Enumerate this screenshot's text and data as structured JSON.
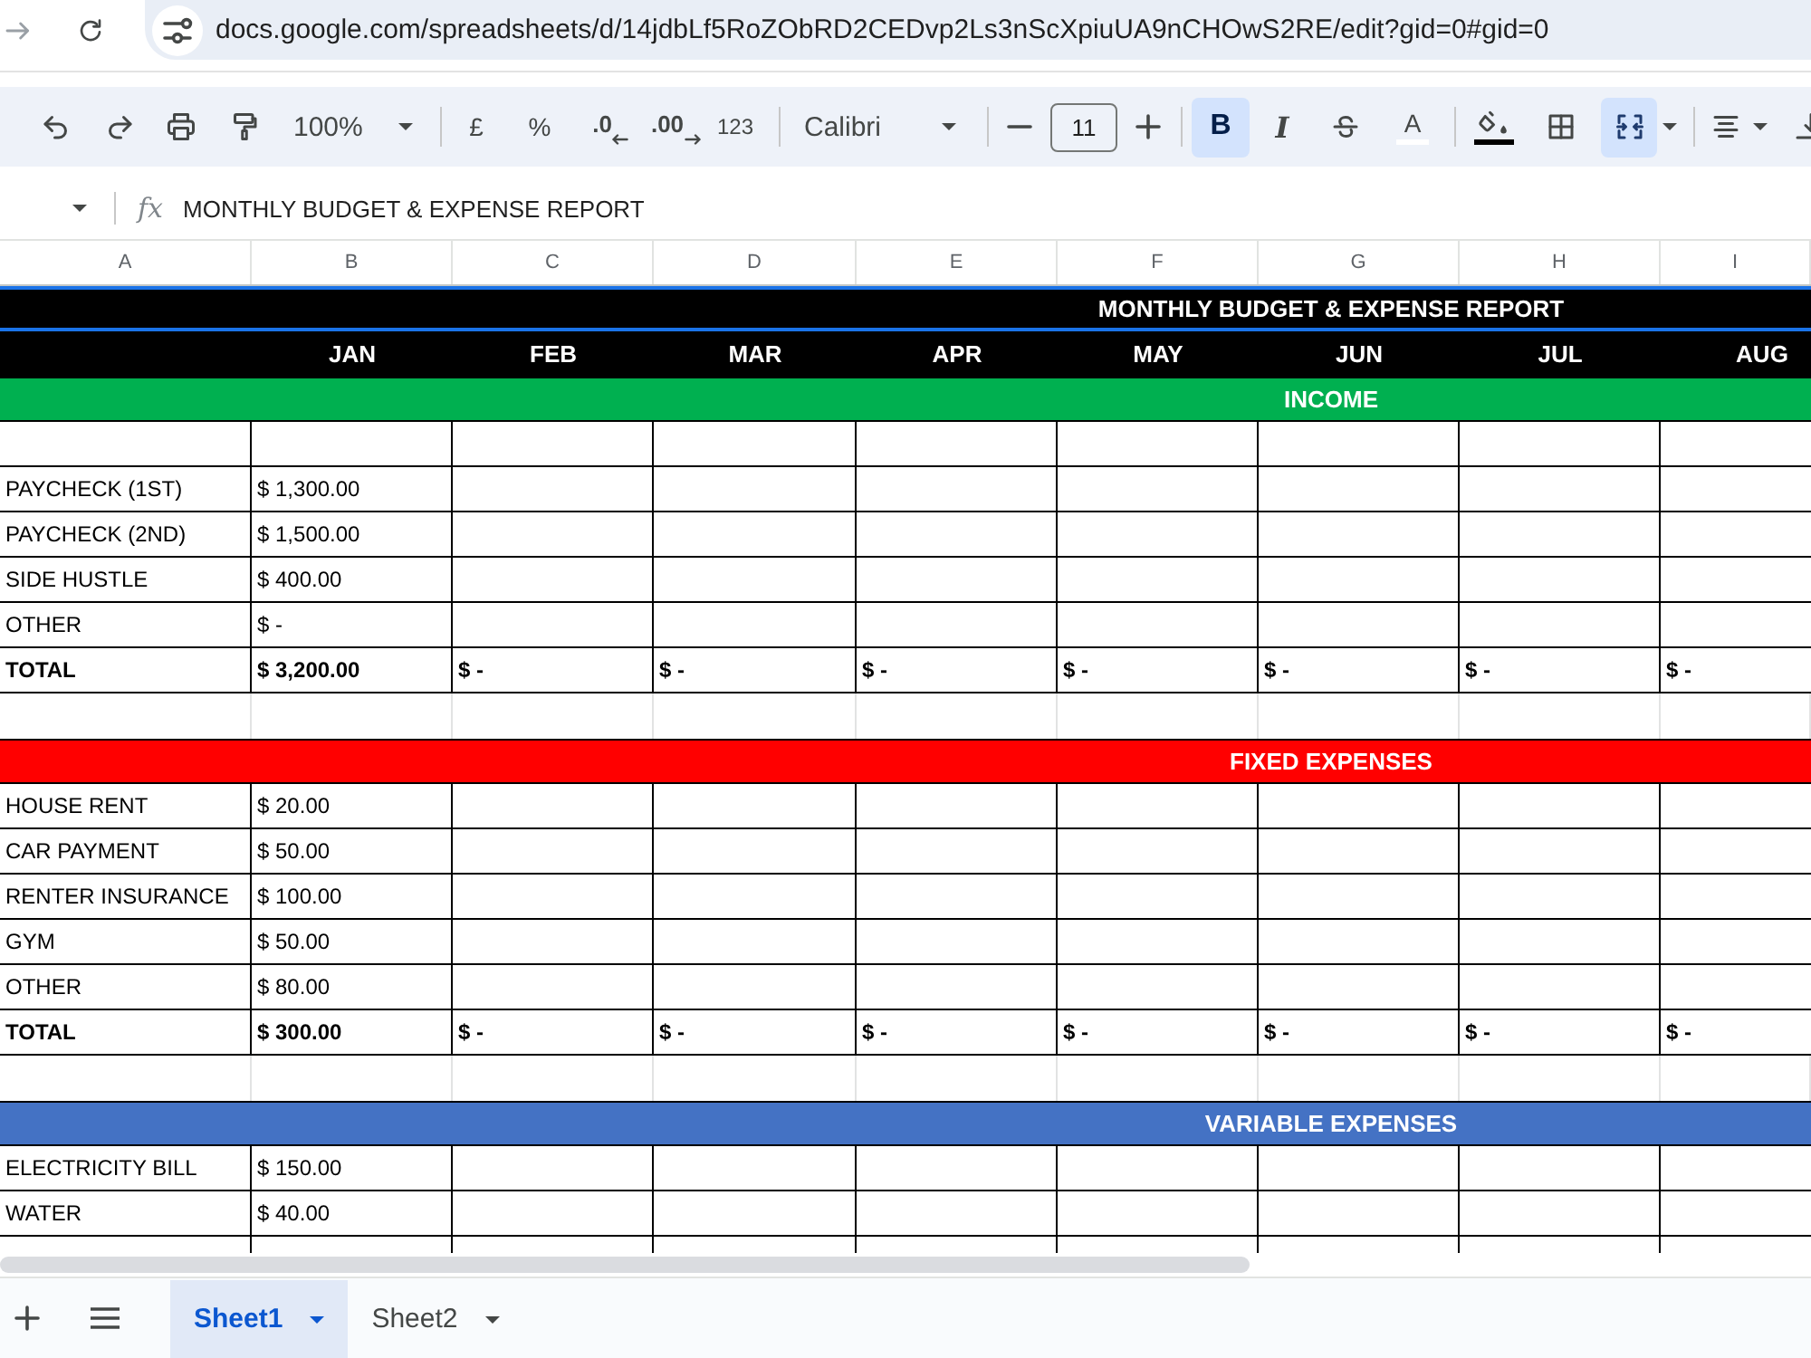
{
  "browser": {
    "url": "docs.google.com/spreadsheets/d/14jdbLf5RoZObRD2CEDvp2Ls3nScXpiuUA9nCHOwS2RE/edit?gid=0#gid=0"
  },
  "toolbar": {
    "zoom": "100%",
    "currency": "£",
    "percent": "%",
    "decrease_decimal": ".0",
    "increase_decimal": ".00",
    "number_format": "123",
    "font": "Calibri",
    "font_size": "11",
    "bold": {
      "label": "B",
      "on": true
    },
    "italic": {
      "label": "I",
      "on": false
    },
    "strikethrough": {
      "on": false
    },
    "text_color": {
      "label": "A",
      "color": "#ffffff"
    },
    "fill_color": {
      "color": "#000000"
    },
    "merge_cells": {
      "on": true
    }
  },
  "formula_bar": {
    "fx": "fx",
    "value": "MONTHLY BUDGET & EXPENSE REPORT"
  },
  "sheet": {
    "columns": [
      "A",
      "B",
      "C",
      "D",
      "E",
      "F",
      "G",
      "H",
      "I"
    ],
    "rows": [
      {
        "kind": "title",
        "text": "MONTHLY BUDGET & EXPENSE REPORT",
        "selected": true
      },
      {
        "kind": "months",
        "cells": [
          "JAN",
          "FEB",
          "MAR",
          "APR",
          "MAY",
          "JUN",
          "JUL",
          "AUG"
        ],
        "selected": false
      },
      {
        "kind": "section",
        "text": "INCOME",
        "color": "#00b050",
        "selected": false
      },
      {
        "kind": "empty",
        "selected": false
      },
      {
        "kind": "item",
        "cells": [
          "PAYCHECK (1ST)",
          "$ 1,300.00"
        ],
        "selected": false
      },
      {
        "kind": "item",
        "cells": [
          "PAYCHECK (2ND)",
          "$ 1,500.00"
        ],
        "selected": false
      },
      {
        "kind": "item",
        "cells": [
          "SIDE HUSTLE",
          "$ 400.00"
        ],
        "selected": false
      },
      {
        "kind": "item",
        "cells": [
          "OTHER",
          "$ -"
        ],
        "selected": false
      },
      {
        "kind": "total",
        "cells": [
          "TOTAL",
          "$ 3,200.00",
          "$ -",
          "$ -",
          "$ -",
          "$ -",
          "$ -",
          "$ -",
          "$ -"
        ],
        "selected": false
      },
      {
        "kind": "spacer",
        "selected": false
      },
      {
        "kind": "section",
        "text": "FIXED EXPENSES",
        "color": "#ff0000",
        "selected": false
      },
      {
        "kind": "item",
        "cells": [
          "HOUSE RENT",
          "$ 20.00"
        ],
        "selected": false
      },
      {
        "kind": "item",
        "cells": [
          "CAR PAYMENT",
          "$ 50.00"
        ],
        "selected": false
      },
      {
        "kind": "item",
        "cells": [
          "RENTER INSURANCE",
          "$ 100.00"
        ],
        "selected": false
      },
      {
        "kind": "item",
        "cells": [
          "GYM",
          "$ 50.00"
        ],
        "selected": false
      },
      {
        "kind": "item",
        "cells": [
          "OTHER",
          "$ 80.00"
        ],
        "selected": false
      },
      {
        "kind": "total",
        "cells": [
          "TOTAL",
          "$ 300.00",
          "$ -",
          "$ -",
          "$ -",
          "$ -",
          "$ -",
          "$ -",
          "$ -"
        ],
        "selected": false
      },
      {
        "kind": "spacer",
        "selected": false
      },
      {
        "kind": "section",
        "text": "VARIABLE EXPENSES",
        "color": "#4472c4",
        "selected": false
      },
      {
        "kind": "item",
        "cells": [
          "ELECTRICITY BILL",
          "$ 150.00"
        ],
        "selected": false
      },
      {
        "kind": "item",
        "cells": [
          "WATER",
          "$ 40.00"
        ],
        "selected": false
      },
      {
        "kind": "empty",
        "selected": false
      }
    ]
  },
  "sheet_tabs": [
    {
      "label": "Sheet1",
      "selected": true
    },
    {
      "label": "Sheet2",
      "selected": false
    }
  ]
}
